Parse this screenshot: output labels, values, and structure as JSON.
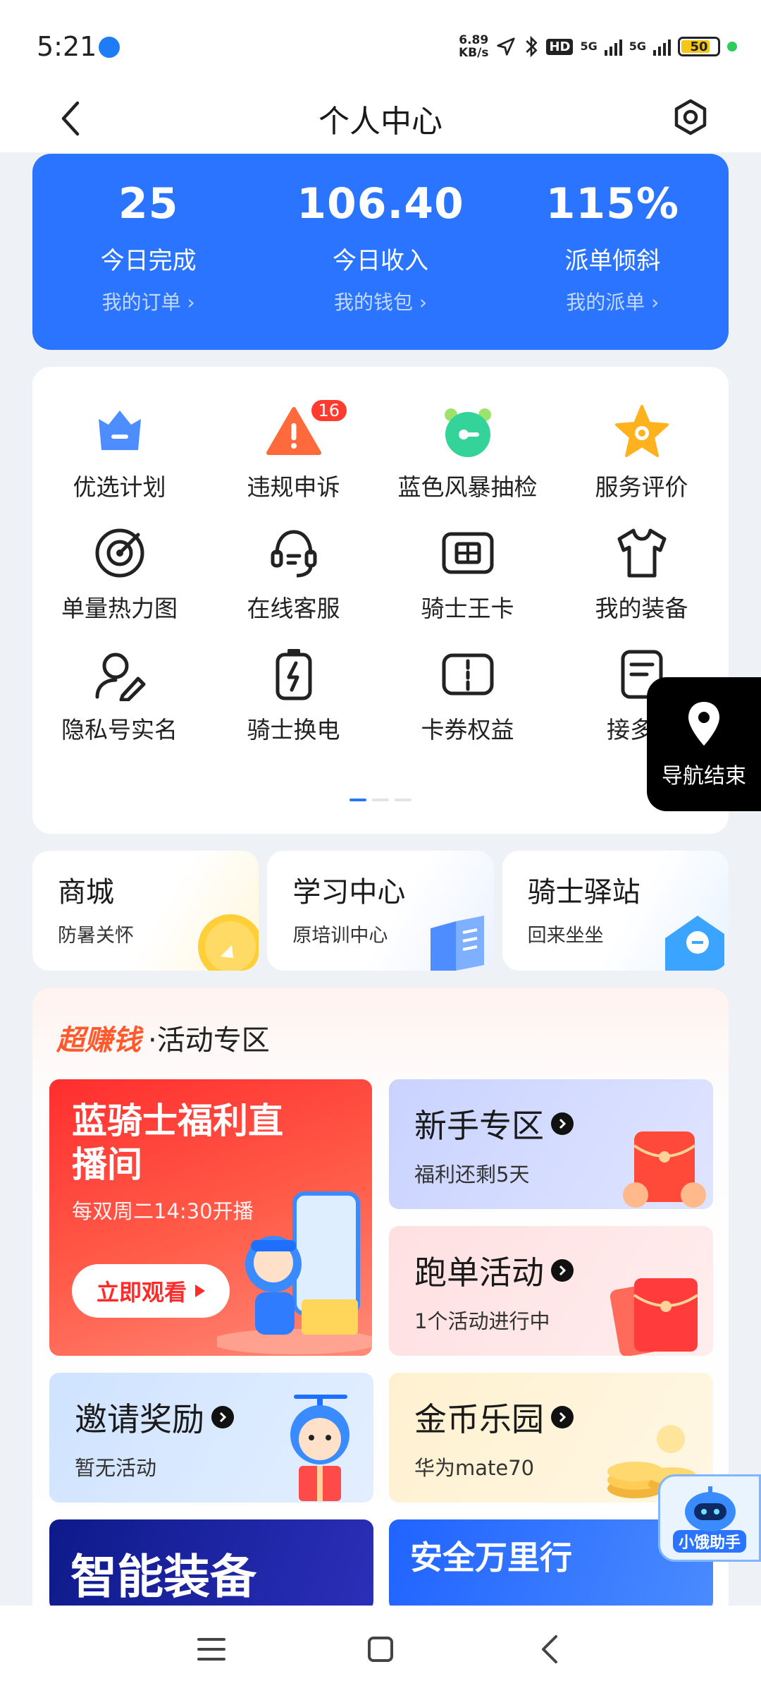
{
  "status_bar": {
    "time": "5:21",
    "net_speed_value": "6.89",
    "net_speed_unit": "KB/s",
    "hd_label": "HD",
    "net_1": "5G",
    "net_2": "5G",
    "battery": "50"
  },
  "header": {
    "title": "个人中心"
  },
  "stats": [
    {
      "value": "25",
      "label": "今日完成",
      "link": "我的订单 ›"
    },
    {
      "value": "106.40",
      "label": "今日收入",
      "link": "我的钱包 ›"
    },
    {
      "value": "115%",
      "label": "派单倾斜",
      "link": "我的派单 ›"
    }
  ],
  "services": [
    {
      "label": "优选计划",
      "icon": "crown-icon"
    },
    {
      "label": "违规申诉",
      "icon": "warning-icon",
      "badge": "16"
    },
    {
      "label": "蓝色风暴抽检",
      "icon": "alarm-icon"
    },
    {
      "label": "服务评价",
      "icon": "star-icon"
    },
    {
      "label": "单量热力图",
      "icon": "target-icon"
    },
    {
      "label": "在线客服",
      "icon": "headset-icon"
    },
    {
      "label": "骑士王卡",
      "icon": "sim-card-icon"
    },
    {
      "label": "我的装备",
      "icon": "shirt-icon"
    },
    {
      "label": "隐私号实名",
      "icon": "user-edit-icon"
    },
    {
      "label": "骑士换电",
      "icon": "battery-swap-icon"
    },
    {
      "label": "卡券权益",
      "icon": "coupon-icon"
    },
    {
      "label": "接多种",
      "icon": "document-icon"
    }
  ],
  "nav_end": {
    "label": "导航结束"
  },
  "quick_cards": [
    {
      "title": "商城",
      "subtitle": "防暑关怀"
    },
    {
      "title": "学习中心",
      "subtitle": "原培训中心"
    },
    {
      "title": "骑士驿站",
      "subtitle": "回来坐坐"
    }
  ],
  "activity": {
    "brand": "超赚钱",
    "title": "·活动专区",
    "live": {
      "title": "蓝骑士福利直播间",
      "subtitle": "每双周二14:30开播",
      "button": "立即观看"
    },
    "tiles": {
      "new": {
        "title": "新手专区",
        "subtitle": "福利还剩5天"
      },
      "run": {
        "title": "跑单活动",
        "subtitle": "1个活动进行中"
      },
      "invite": {
        "title": "邀请奖励",
        "subtitle": "暂无活动"
      },
      "gold": {
        "title": "金币乐园",
        "subtitle": "华为mate70"
      }
    },
    "promos": {
      "smart": "智能装备",
      "safe": "安全万里行"
    }
  },
  "assistant": {
    "label": "小饿助手"
  },
  "colors": {
    "primary": "#2a74ff",
    "badge": "#ff3b30",
    "brand_orange": "#ff5a2d"
  }
}
